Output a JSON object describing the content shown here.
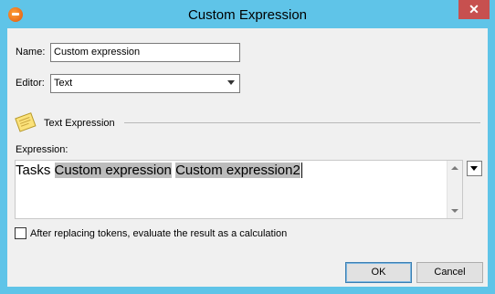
{
  "window": {
    "title": "Custom Expression",
    "close_label": "✕"
  },
  "form": {
    "name_label": "Name:",
    "name_value": "Custom expression",
    "editor_label": "Editor:",
    "editor_value": "Text"
  },
  "section": {
    "title": "Text Expression",
    "icon": "note-icon"
  },
  "expression": {
    "label": "Expression:",
    "prefix": "Tasks ",
    "tokens": [
      "Custom expression",
      "Custom expression2"
    ]
  },
  "options": {
    "evaluate_checkbox_label": "After replacing tokens, evaluate the result as a calculation",
    "evaluate_checked": false
  },
  "buttons": {
    "ok_label": "OK",
    "cancel_label": "Cancel"
  },
  "colors": {
    "frame": "#5fc4e8",
    "close_button": "#c7504f",
    "token_highlight": "#bcbcbc"
  }
}
